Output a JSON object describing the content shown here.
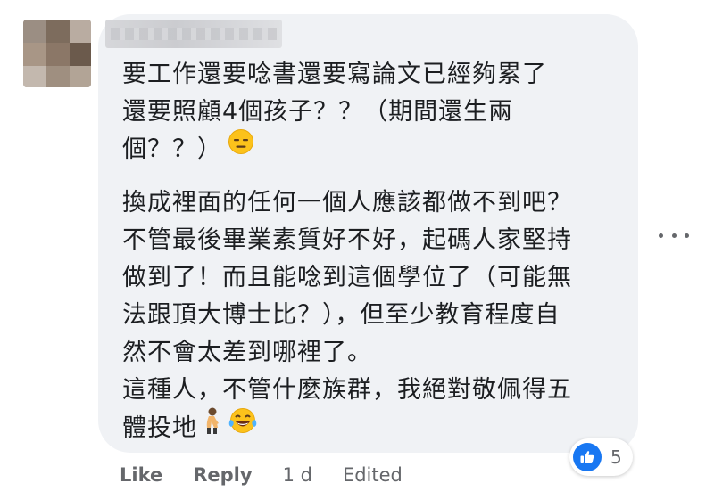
{
  "comment": {
    "lines": [
      "要工作還要唸書還要寫論文已經夠累了",
      "還要照顧4個孩子？？（期間還生兩",
      "個？？）",
      "換成裡面的任何一個人應該都做不到吧？",
      "不管最後畢業素質好不好，起碼人家堅持",
      "做到了！而且能唸到這個學位了（可能無",
      "法跟頂大博士比？），但至少教育程度自",
      "然不會太差到哪裡了。",
      "這種人，不管什麼族群，我絕對敬佩得五",
      "體投地"
    ],
    "emojis": {
      "line3": "expressionless-face-emoji",
      "line10_a": "person-bowing-emoji",
      "line10_b": "tears-of-joy-emoji"
    }
  },
  "reactions": {
    "icon": "thumbs-up-icon",
    "count": "5",
    "color": "#1877f2"
  },
  "actions": {
    "like": "Like",
    "reply": "Reply",
    "time": "1 d",
    "edited": "Edited"
  },
  "more_icon": "more-options-icon",
  "colors": {
    "bubble": "#f0f2f5",
    "text": "#1c1e21",
    "secondary": "#65676b"
  }
}
